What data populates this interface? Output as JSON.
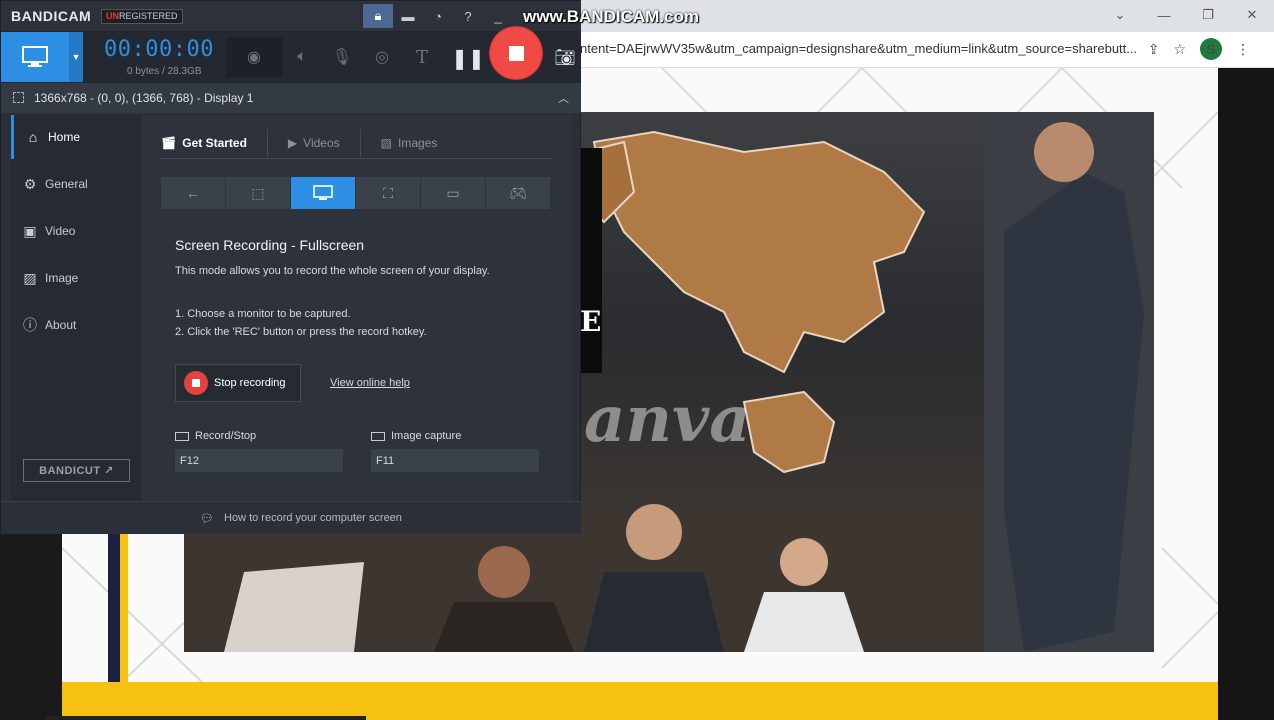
{
  "browser": {
    "url": "ntent=DAEjrwWV35w&utm_campaign=designshare&utm_medium=link&utm_source=sharebutt...",
    "profile_initial": "S",
    "win_min": "—",
    "win_max": "❐",
    "win_close": "✕",
    "tab_dropdown": "⌄"
  },
  "slide": {
    "watermark_text": "anva",
    "partial_letter": "E"
  },
  "bandicam": {
    "logo": "BANDICAM",
    "badge_prefix": "UN",
    "badge_rest": "REGISTERED",
    "watermark_url": "www.BANDICAM.com",
    "timer": "00:00:00",
    "bytes": "0 bytes / 28.3GB",
    "region": "1366x768 - (0, 0), (1366, 768) - Display 1",
    "sidebar": [
      {
        "label": "Home",
        "icon": "home-icon"
      },
      {
        "label": "General",
        "icon": "gear-icon"
      },
      {
        "label": "Video",
        "icon": "video-icon"
      },
      {
        "label": "Image",
        "icon": "image-icon"
      },
      {
        "label": "About",
        "icon": "info-icon"
      }
    ],
    "bandicut_label": "BANDICUT ↗",
    "tabs": [
      {
        "label": "Get Started"
      },
      {
        "label": "Videos"
      },
      {
        "label": "Images"
      }
    ],
    "title": "Screen Recording - Fullscreen",
    "description": "This mode allows you to record the whole screen of your display.",
    "step1": "1. Choose a monitor to be captured.",
    "step2": "2. Click the 'REC' button or press the record hotkey.",
    "stop_label": "Stop recording",
    "help_link": "View online help",
    "hotkey_record_label": "Record/Stop",
    "hotkey_record_value": "F12",
    "hotkey_image_label": "Image capture",
    "hotkey_image_value": "F11",
    "footer": "How to record your computer screen"
  }
}
